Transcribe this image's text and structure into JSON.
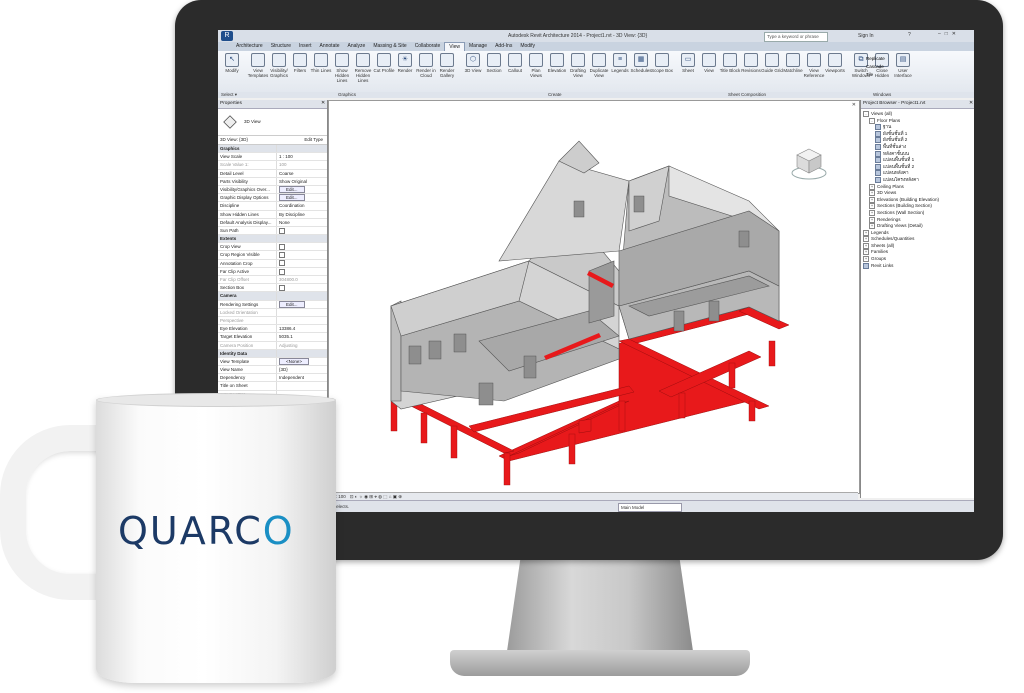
{
  "app": {
    "title": "Autodesk Revit Architecture 2014 -  Project1.rvt - 3D View: {3D}",
    "search_placeholder": "Type a keyword or phrase",
    "sign_in": "Sign In",
    "logo": "R"
  },
  "tabs": [
    "Architecture",
    "Structure",
    "Insert",
    "Annotate",
    "Analyze",
    "Massing & Site",
    "Collaborate",
    "View",
    "Manage",
    "Add-Ins",
    "Modify"
  ],
  "active_tab": "View",
  "ribbon": {
    "buttons": [
      {
        "label": "Modify",
        "icon": "cursor-icon"
      },
      {
        "label": "View Templates",
        "icon": "template-icon"
      },
      {
        "label": "Visibility/ Graphics",
        "icon": "visibility-icon"
      },
      {
        "label": "Filters",
        "icon": "filter-icon"
      },
      {
        "label": "Thin Lines",
        "icon": "thin-lines-icon"
      },
      {
        "label": "Show Hidden Lines",
        "icon": "show-hidden-icon"
      },
      {
        "label": "Remove Hidden Lines",
        "icon": "remove-hidden-icon"
      },
      {
        "label": "Cut Profile",
        "icon": "cut-profile-icon"
      },
      {
        "label": "Render",
        "icon": "render-icon"
      },
      {
        "label": "Render in Cloud",
        "icon": "cloud-render-icon"
      },
      {
        "label": "Render Gallery",
        "icon": "gallery-icon"
      },
      {
        "label": "3D View",
        "icon": "3d-view-icon"
      },
      {
        "label": "Section",
        "icon": "section-icon"
      },
      {
        "label": "Callout",
        "icon": "callout-icon"
      },
      {
        "label": "Plan Views",
        "icon": "plan-icon"
      },
      {
        "label": "Elevation",
        "icon": "elevation-icon"
      },
      {
        "label": "Drafting View",
        "icon": "drafting-icon"
      },
      {
        "label": "Duplicate View",
        "icon": "duplicate-icon"
      },
      {
        "label": "Legends",
        "icon": "legend-icon"
      },
      {
        "label": "Schedules",
        "icon": "schedule-icon"
      },
      {
        "label": "Scope Box",
        "icon": "scope-box-icon"
      },
      {
        "label": "Sheet",
        "icon": "sheet-icon"
      },
      {
        "label": "View",
        "icon": "view-icon"
      },
      {
        "label": "Title Block",
        "icon": "title-block-icon"
      },
      {
        "label": "Revisions",
        "icon": "revisions-icon"
      },
      {
        "label": "Guide Grid",
        "icon": "grid-icon"
      },
      {
        "label": "Matchline",
        "icon": "matchline-icon"
      },
      {
        "label": "View Reference",
        "icon": "view-reference-icon"
      },
      {
        "label": "Viewports",
        "icon": "viewports-icon"
      },
      {
        "label": "Switch Windows",
        "icon": "switch-windows-icon"
      },
      {
        "label": "Close Hidden",
        "icon": "close-hidden-icon"
      },
      {
        "label": "User Interface",
        "icon": "ui-icon"
      }
    ],
    "window_items": [
      "Replicate",
      "Cascade",
      "Tile"
    ],
    "panels": [
      "Select ▾",
      "Graphics",
      "Create",
      "Sheet Composition",
      "Windows"
    ]
  },
  "properties": {
    "title": "Properties",
    "type_name": "3D View",
    "type_selector": "3D View: {3D}",
    "edit_type": "Edit Type",
    "rows": [
      {
        "k": "Graphics",
        "v": "",
        "grp": true
      },
      {
        "k": "View Scale",
        "v": "1 : 100"
      },
      {
        "k": "Scale Value    1:",
        "v": "100",
        "dim": true
      },
      {
        "k": "Detail Level",
        "v": "Coarse"
      },
      {
        "k": "Parts Visibility",
        "v": "Show Original"
      },
      {
        "k": "Visibility/Graphics Over...",
        "v": "Edit...",
        "btn": true
      },
      {
        "k": "Graphic Display Options",
        "v": "Edit...",
        "btn": true
      },
      {
        "k": "Discipline",
        "v": "Coordination"
      },
      {
        "k": "Show Hidden Lines",
        "v": "By Discipline"
      },
      {
        "k": "Default Analysis Display...",
        "v": "None"
      },
      {
        "k": "Sun Path",
        "v": "",
        "chk": true
      },
      {
        "k": "Extents",
        "v": "",
        "grp": true
      },
      {
        "k": "Crop View",
        "v": "",
        "chk": true
      },
      {
        "k": "Crop Region Visible",
        "v": "",
        "chk": true
      },
      {
        "k": "Annotation Crop",
        "v": "",
        "chk": true
      },
      {
        "k": "Far Clip Active",
        "v": "",
        "chk": true
      },
      {
        "k": "Far Clip Offset",
        "v": "304800.0",
        "dim": true
      },
      {
        "k": "Section Box",
        "v": "",
        "chk": true
      },
      {
        "k": "Camera",
        "v": "",
        "grp": true
      },
      {
        "k": "Rendering Settings",
        "v": "Edit...",
        "btn": true
      },
      {
        "k": "Locked Orientation",
        "v": "",
        "dim": true
      },
      {
        "k": "Perspective",
        "v": "",
        "dim": true
      },
      {
        "k": "Eye Elevation",
        "v": "13386.4"
      },
      {
        "k": "Target Elevation",
        "v": "5035.1"
      },
      {
        "k": "Camera Position",
        "v": "Adjusting",
        "dim": true
      },
      {
        "k": "Identity Data",
        "v": "",
        "grp": true
      },
      {
        "k": "View Template",
        "v": "<None>",
        "btn": true
      },
      {
        "k": "View Name",
        "v": "{3D}"
      },
      {
        "k": "Dependency",
        "v": "Independent"
      },
      {
        "k": "Title on Sheet",
        "v": ""
      },
      {
        "k": "TITLE VIEW",
        "v": ""
      }
    ]
  },
  "viewport": {
    "scale": "1 : 100"
  },
  "browser": {
    "title": "Project Browser - Project1.rvt",
    "nodes": [
      {
        "label": "Views (all)",
        "level": 0,
        "exp": "-"
      },
      {
        "label": "Floor Plans",
        "level": 1,
        "exp": "-"
      },
      {
        "label": "ฐาน",
        "level": 2
      },
      {
        "label": "ผังชั้นชั้นที่ 1",
        "level": 2
      },
      {
        "label": "ผังชั้นชั้นที่ 2",
        "level": 2
      },
      {
        "label": "พื้นที่ชั้นล่าง",
        "level": 2
      },
      {
        "label": "หลังคาชั้นบน",
        "level": 2
      },
      {
        "label": "แปลนพื้นชั้นที่ 1",
        "level": 2
      },
      {
        "label": "แปลนพื้นชั้นที่ 2",
        "level": 2
      },
      {
        "label": "แปลนหลังคา",
        "level": 2
      },
      {
        "label": "แปลนโครงหลังคา",
        "level": 2
      },
      {
        "label": "Ceiling Plans",
        "level": 1,
        "exp": "+"
      },
      {
        "label": "3D Views",
        "level": 1,
        "exp": "+"
      },
      {
        "label": "Elevations (Building Elevation)",
        "level": 1,
        "exp": "+"
      },
      {
        "label": "Sections (Building Section)",
        "level": 1,
        "exp": "+"
      },
      {
        "label": "Sections (Wall Section)",
        "level": 1,
        "exp": "+"
      },
      {
        "label": "Renderings",
        "level": 1,
        "exp": "+"
      },
      {
        "label": "Drafting Views (Detail)",
        "level": 1,
        "exp": "+"
      },
      {
        "label": "Legends",
        "level": 0,
        "exp": "+"
      },
      {
        "label": "Schedules/Quantities",
        "level": 0,
        "exp": "+"
      },
      {
        "label": "Sheets (all)",
        "level": 0,
        "exp": "+"
      },
      {
        "label": "Families",
        "level": 0,
        "exp": "+"
      },
      {
        "label": "Groups",
        "level": 0,
        "exp": "+"
      },
      {
        "label": "Revit Links",
        "level": 0,
        "exp": ""
      }
    ]
  },
  "statusbar": {
    "message": "Click to select, TAB for alternates, CTRL adds, SHIFT unselects.",
    "model": "Main Model"
  },
  "mug": {
    "brand": "QUARCO"
  },
  "colors": {
    "foundation": "#e8191b",
    "wall": "#c8c8c8",
    "brand_dark": "#1c3a66",
    "brand_light": "#1a8fc4"
  }
}
